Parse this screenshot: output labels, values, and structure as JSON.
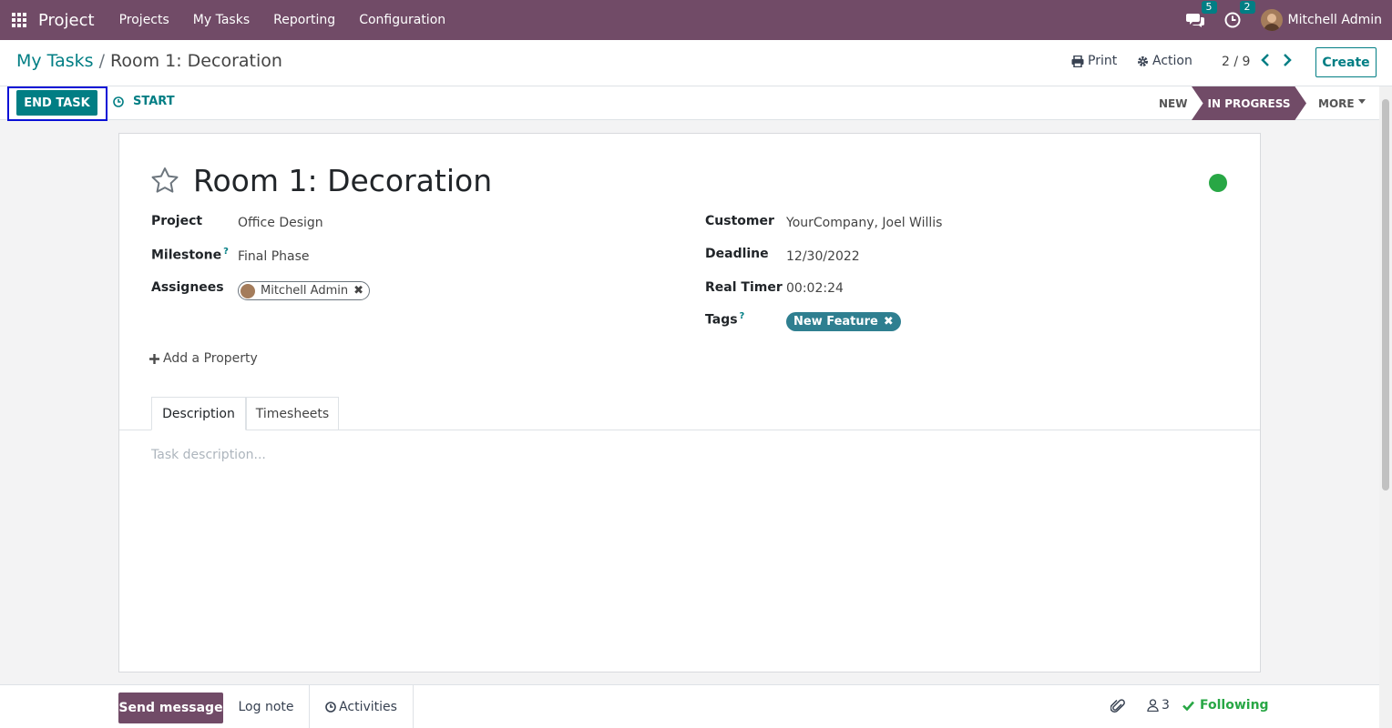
{
  "navbar": {
    "app_name": "Project",
    "menu": [
      "Projects",
      "My Tasks",
      "Reporting",
      "Configuration"
    ],
    "messages_count": "5",
    "activities_count": "2",
    "user_name": "Mitchell Admin"
  },
  "breadcrumb": {
    "parent": "My Tasks",
    "separator": "/",
    "current": "Room 1: Decoration"
  },
  "control_panel": {
    "print_label": "Print",
    "action_label": "Action",
    "pager": "2 / 9",
    "create_label": "Create"
  },
  "statusbar": {
    "end_task_label": "END TASK",
    "start_label": "START",
    "stages": [
      "NEW",
      "IN PROGRESS",
      "MORE"
    ],
    "active_stage": "IN PROGRESS"
  },
  "task": {
    "title": "Room 1: Decoration",
    "kanban_state_color": "#28a745",
    "fields_left": [
      {
        "label": "Project",
        "value": "Office Design"
      },
      {
        "label": "Milestone",
        "value": "Final Phase",
        "help": "?"
      },
      {
        "label": "Assignees",
        "value": "Mitchell Admin"
      }
    ],
    "fields_right": [
      {
        "label": "Customer",
        "value": "YourCompany, Joel Willis"
      },
      {
        "label": "Deadline",
        "value": "12/30/2022"
      },
      {
        "label": "Real Timer",
        "value": "00:02:24"
      },
      {
        "label": "Tags",
        "value": "New Feature",
        "help": "?"
      }
    ],
    "add_property_label": "Add a Property",
    "tabs": [
      "Description",
      "Timesheets"
    ],
    "active_tab": "Description",
    "description_placeholder": "Task description..."
  },
  "chatter": {
    "send_message_label": "Send message",
    "log_note_label": "Log note",
    "activities_label": "Activities",
    "followers_count": "3",
    "following_label": "Following"
  },
  "colors": {
    "brand": "#714b67",
    "accent": "#017e84",
    "tag": "#2f7f90",
    "focus_outline": "#0a10d6"
  }
}
